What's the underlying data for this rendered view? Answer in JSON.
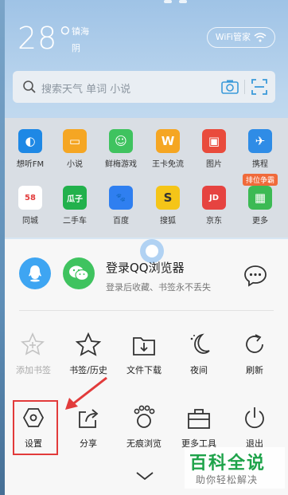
{
  "weather": {
    "temp": "28°",
    "city": "镇海",
    "condition": "阴"
  },
  "wifi_button": {
    "label": "WiFi管家"
  },
  "search": {
    "placeholder": "搜索天气 单词 小说"
  },
  "apps": [
    {
      "label": "想听FM",
      "color": "#1e88e5"
    },
    {
      "label": "小说",
      "color": "#f5a623"
    },
    {
      "label": "鲜梅游戏",
      "color": "#3fc35f"
    },
    {
      "label": "王卡免流",
      "color": "#f5a623"
    },
    {
      "label": "图片",
      "color": "#e94b3c"
    },
    {
      "label": "携程",
      "color": "#2f8ce6"
    },
    {
      "label": "同城",
      "color": "#ffffff"
    },
    {
      "label": "二手车",
      "color": "#22b14c"
    },
    {
      "label": "百度",
      "color": "#2f7ff0"
    },
    {
      "label": "搜狐",
      "color": "#f5c518"
    },
    {
      "label": "京东",
      "color": "#e64340"
    },
    {
      "label": "更多",
      "color": "#3cba54"
    }
  ],
  "badge": "排位争霸",
  "login": {
    "title": "登录QQ浏览器",
    "subtitle": "登录后收藏、书签永不丢失"
  },
  "menu_row1": [
    {
      "label": "添加书签",
      "disabled": true
    },
    {
      "label": "书签/历史"
    },
    {
      "label": "文件下载"
    },
    {
      "label": "夜间"
    },
    {
      "label": "刷新"
    }
  ],
  "menu_row2": [
    {
      "label": "设置"
    },
    {
      "label": "分享"
    },
    {
      "label": "无痕浏览"
    },
    {
      "label": "更多工具"
    },
    {
      "label": "退出"
    }
  ],
  "watermark": {
    "title": "百科全说",
    "subtitle": "助你轻松解决"
  },
  "colors": {
    "highlight": "#e23b3b",
    "qq": "#3ea5f2",
    "wechat": "#3fc35f"
  }
}
